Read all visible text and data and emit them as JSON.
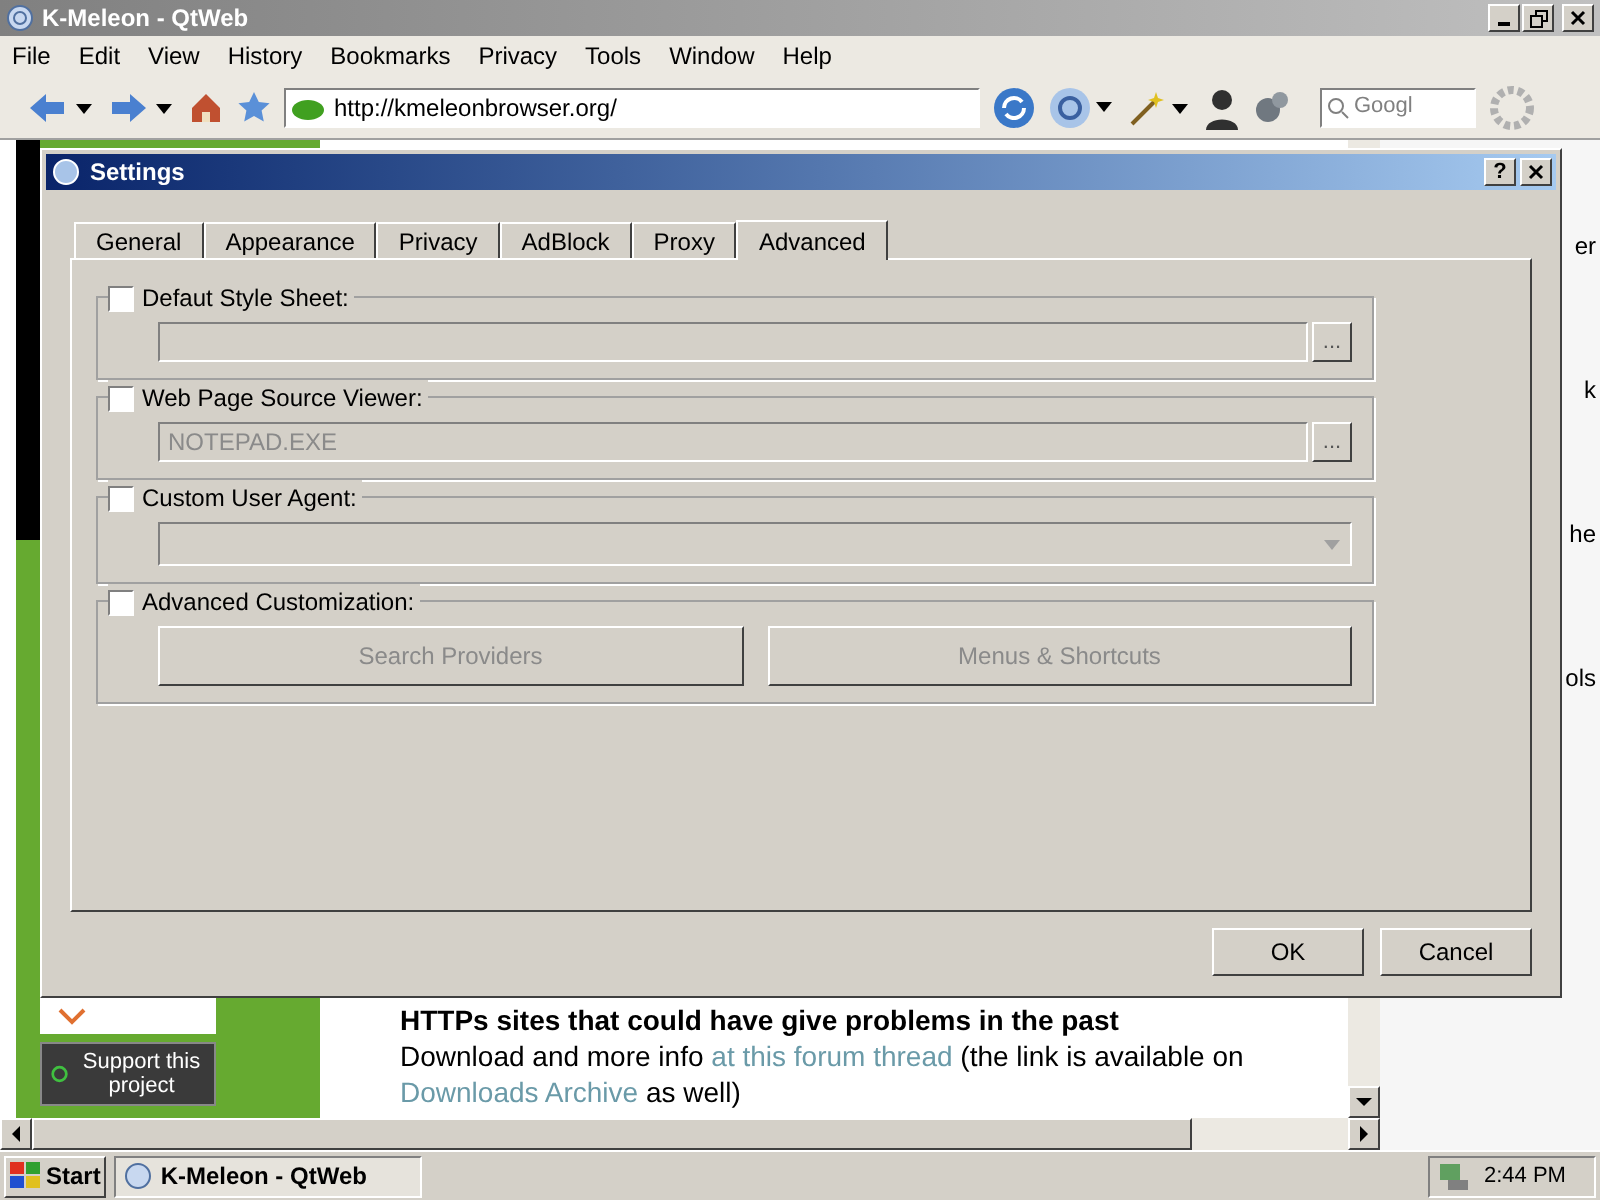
{
  "browser": {
    "title": "K-Meleon - QtWeb",
    "menu": [
      "File",
      "Edit",
      "View",
      "History",
      "Bookmarks",
      "Privacy",
      "Tools",
      "Window",
      "Help"
    ],
    "address": "http://kmeleonbrowser.org/",
    "search_placeholder": "Googl"
  },
  "page": {
    "side_fragments": [
      "er",
      "k",
      "he",
      "ols"
    ],
    "support_button": "Support this project",
    "heading": "HTTPs sites that could have give problems in the past",
    "paragraph": [
      {
        "kind": "text",
        "text": "Download and more info "
      },
      {
        "kind": "link",
        "text": "at this forum thread"
      },
      {
        "kind": "text",
        "text": " (the link is available on "
      },
      {
        "kind": "link",
        "text": "Downloads Archive"
      },
      {
        "kind": "text",
        "text": " as well)"
      }
    ]
  },
  "dialog": {
    "title": "Settings",
    "help": "?",
    "tabs": [
      {
        "label": "General",
        "selected": false
      },
      {
        "label": "Appearance",
        "selected": false
      },
      {
        "label": "Privacy",
        "selected": false
      },
      {
        "label": "AdBlock",
        "selected": false
      },
      {
        "label": "Proxy",
        "selected": false
      },
      {
        "label": "Advanced",
        "selected": true
      }
    ],
    "groups": [
      {
        "kind": "file",
        "label": "Defaut Style Sheet:",
        "checked": false,
        "browse": "..."
      },
      {
        "kind": "file",
        "label": "Web Page Source Viewer:",
        "checked": false,
        "value": "NOTEPAD.EXE",
        "browse": "..."
      },
      {
        "kind": "combo",
        "label": "Custom User Agent:",
        "checked": false
      },
      {
        "kind": "buttons",
        "label": "Advanced Customization:",
        "checked": false,
        "buttons": [
          "Search Providers",
          "Menus & Shortcuts"
        ]
      }
    ],
    "buttons": [
      "OK",
      "Cancel"
    ]
  },
  "taskbar": {
    "start": "Start",
    "task": "K-Meleon - QtWeb",
    "time": "2:44 PM"
  }
}
